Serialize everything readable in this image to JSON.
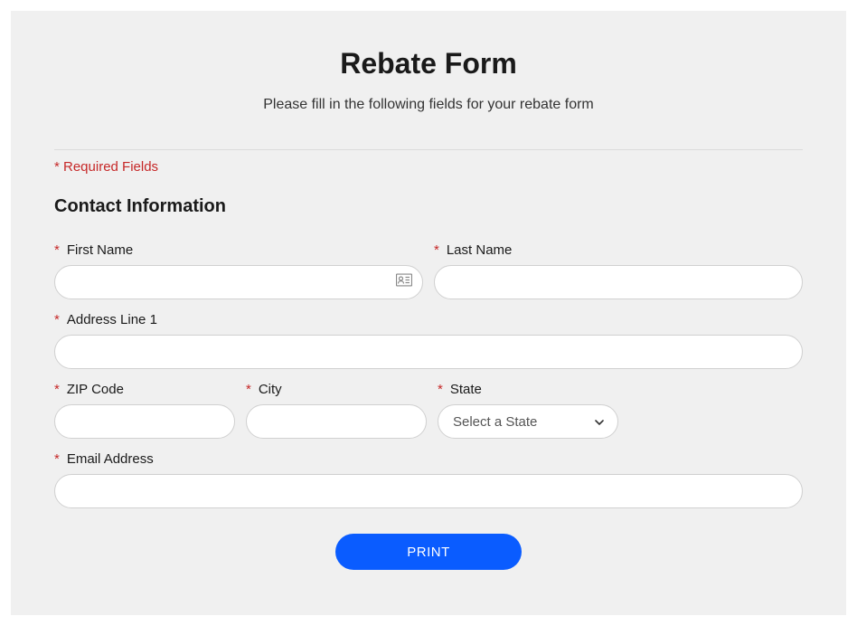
{
  "header": {
    "title": "Rebate Form",
    "subtitle": "Please fill in the following fields for your rebate form",
    "required_note": "* Required Fields"
  },
  "section": {
    "title": "Contact Information"
  },
  "labels": {
    "asterisk": "*",
    "first_name": "First Name",
    "last_name": "Last Name",
    "address1": "Address Line 1",
    "zip": "ZIP Code",
    "city": "City",
    "state": "State",
    "email": "Email Address"
  },
  "state_select": {
    "placeholder": "Select a State"
  },
  "buttons": {
    "print": "PRINT"
  }
}
